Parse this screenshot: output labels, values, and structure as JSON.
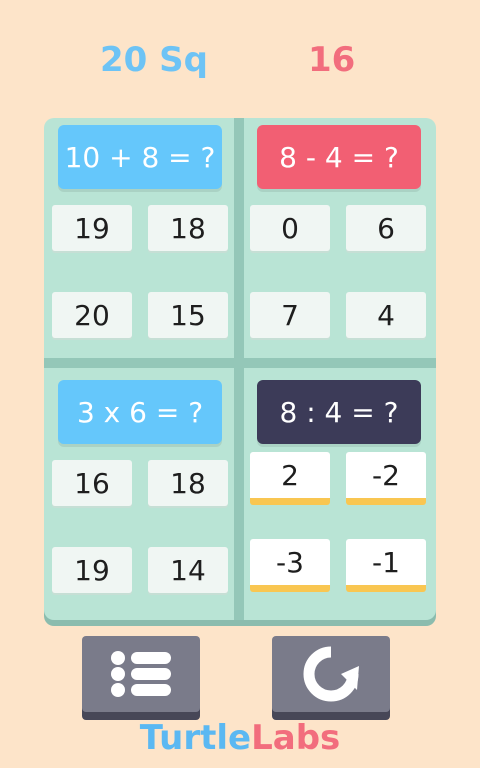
{
  "scores": {
    "blue": "20 Sq",
    "red": "16"
  },
  "quadrants": [
    {
      "question": "10 + 8 = ?",
      "answers": [
        "19",
        "18",
        "20",
        "15"
      ]
    },
    {
      "question": "8 - 4 = ?",
      "answers": [
        "0",
        "6",
        "7",
        "4"
      ]
    },
    {
      "question": "3 x 6 = ?",
      "answers": [
        "16",
        "18",
        "19",
        "14"
      ]
    },
    {
      "question": "8 : 4 = ?",
      "answers": [
        "2",
        "-2",
        "-3",
        "-1"
      ]
    }
  ],
  "controls": {
    "menu_icon": "menu-list-icon",
    "restart_icon": "restart-icon"
  },
  "brand": {
    "part1": "Turtle",
    "part2": "Labs"
  },
  "colors": {
    "background": "#fde4c9",
    "board": "#b9e4d5",
    "blue": "#65c7fb",
    "red": "#f25f73",
    "dark": "#3c3b58",
    "highlight": "#f9c651"
  }
}
